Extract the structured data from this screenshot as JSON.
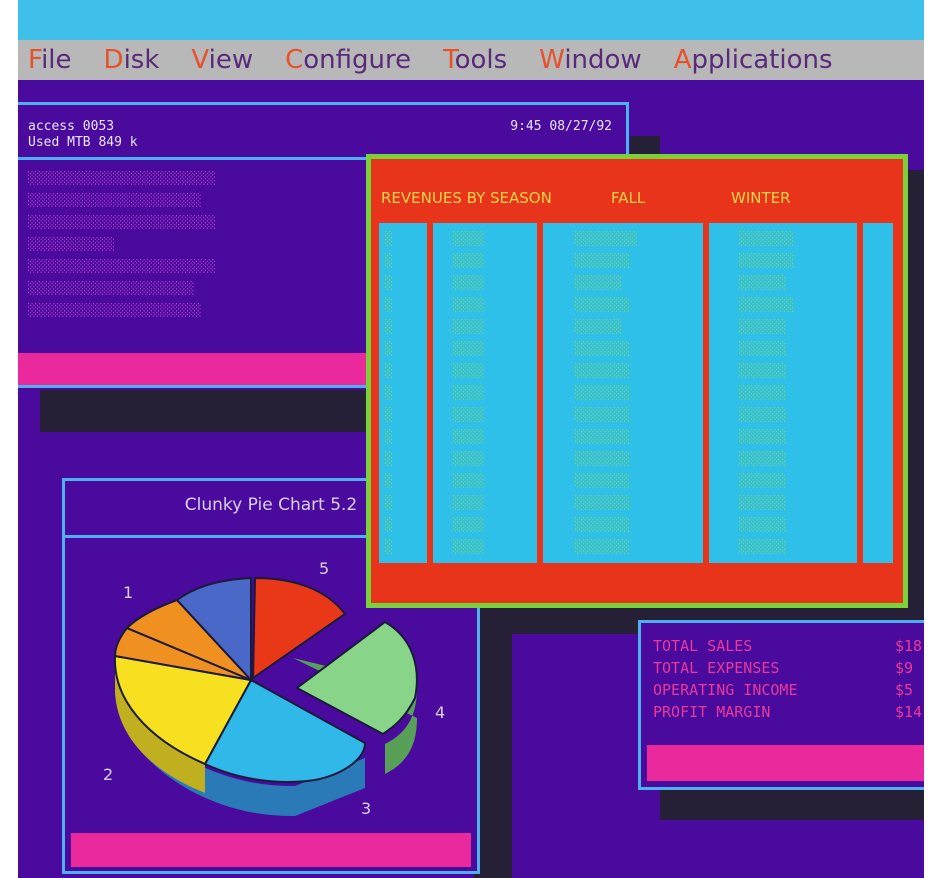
{
  "menu": [
    {
      "hot": "F",
      "rest": "ile"
    },
    {
      "hot": "D",
      "rest": "isk"
    },
    {
      "hot": "V",
      "rest": "iew"
    },
    {
      "hot": "C",
      "rest": "onfigure"
    },
    {
      "hot": "T",
      "rest": "ools"
    },
    {
      "hot": "W",
      "rest": "indow"
    },
    {
      "hot": "A",
      "rest": "pplications"
    }
  ],
  "system_window": {
    "line1": "access 0053",
    "line2": "Used MTB 849 k",
    "time": "9:45 08/27/92"
  },
  "pie_window": {
    "title": "Clunky Pie Chart 5.2",
    "labels": [
      "1",
      "2",
      "3",
      "4",
      "5"
    ]
  },
  "table_window": {
    "header_label": "REVENUES BY SEASON",
    "col_fall": "FALL",
    "col_winter": "WINTER"
  },
  "totals_window": {
    "rows": [
      {
        "label": "TOTAL SALES",
        "value": "$18"
      },
      {
        "label": "TOTAL EXPENSES",
        "value": "$9"
      },
      {
        "label": "OPERATING INCOME",
        "value": "$5"
      },
      {
        "label": "PROFIT MARGIN",
        "value": "$14"
      }
    ]
  },
  "colors": {
    "desktop": "#4a0a9e",
    "menubar": "#b8b8b8",
    "menu_hotkey": "#e8502a",
    "window_border": "#4fb0f0",
    "table_border": "#7ad23a",
    "table_header": "#e8341a",
    "table_cells": "#2ec0e8",
    "accent_bar": "#ea2a9c"
  }
}
